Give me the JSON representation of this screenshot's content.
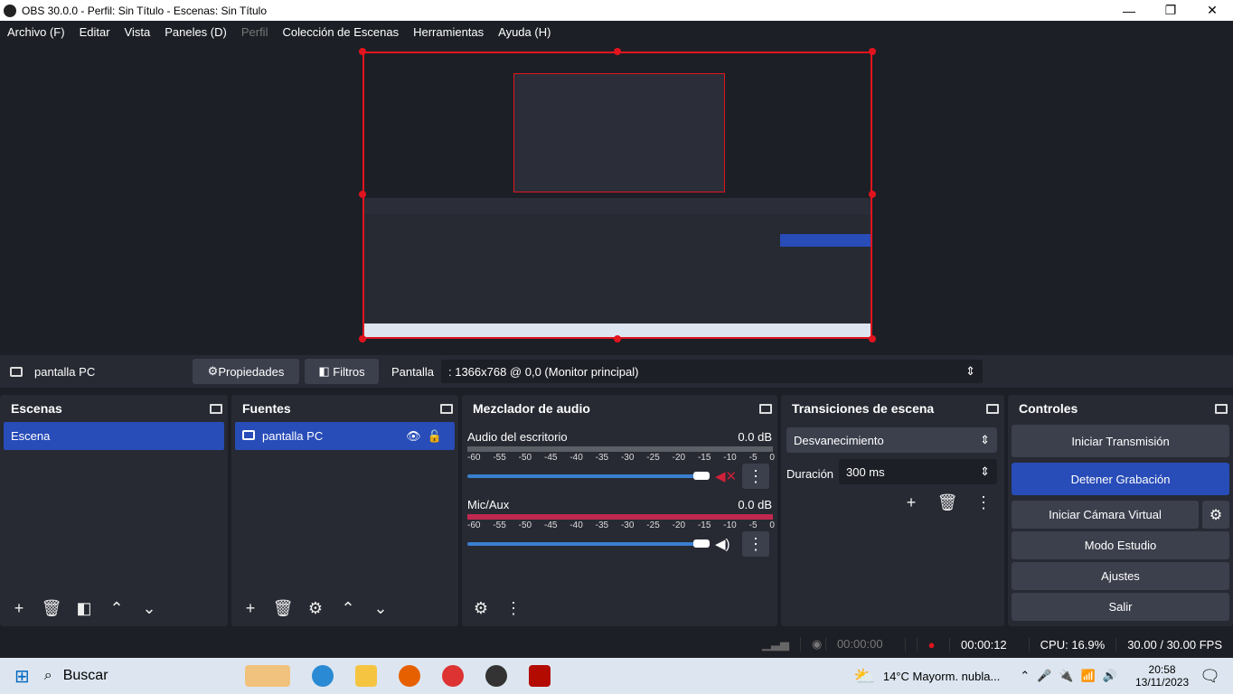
{
  "window": {
    "title": "OBS 30.0.0 - Perfil: Sin Título - Escenas: Sin Título",
    "minimize": "—",
    "maximize": "❐",
    "close": "✕"
  },
  "menu": [
    "Archivo (F)",
    "Editar",
    "Vista",
    "Paneles (D)",
    "Perfil",
    "Colección de Escenas",
    "Herramientas",
    "Ayuda (H)"
  ],
  "source_toolbar": {
    "source_name": "pantalla PC",
    "properties": "Propiedades",
    "filters": "Filtros",
    "display_label": "Pantalla",
    "display_value": ": 1366x768 @ 0,0 (Monitor principal)"
  },
  "scenes": {
    "title": "Escenas",
    "items": [
      "Escena"
    ]
  },
  "sources": {
    "title": "Fuentes",
    "items": [
      "pantalla PC"
    ]
  },
  "mixer": {
    "title": "Mezclador de audio",
    "ticks": [
      "-60",
      "-55",
      "-50",
      "-45",
      "-40",
      "-35",
      "-30",
      "-25",
      "-20",
      "-15",
      "-10",
      "-5",
      "0"
    ],
    "channels": [
      {
        "name": "Audio del escritorio",
        "db": "0.0 dB",
        "muted": true,
        "volume": 1.0
      },
      {
        "name": "Mic/Aux",
        "db": "0.0 dB",
        "muted": false,
        "volume": 1.0
      }
    ]
  },
  "transitions": {
    "title": "Transiciones de escena",
    "selected": "Desvanecimiento",
    "duration_label": "Duración",
    "duration_value": "300 ms"
  },
  "controls": {
    "title": "Controles",
    "buttons": [
      "Iniciar Transmisión",
      "Detener Grabación",
      "Iniciar Cámara Virtual",
      "Modo Estudio",
      "Ajustes",
      "Salir"
    ]
  },
  "status": {
    "stream_time": "00:00:00",
    "rec_time": "00:00:12",
    "cpu": "CPU: 16.9%",
    "fps": "30.00 / 30.00 FPS"
  },
  "taskbar": {
    "search": "Buscar",
    "weather": "14°C  Mayorm. nubla...",
    "time": "20:58",
    "date": "13/11/2023"
  },
  "colors": {
    "accent": "#284cb8",
    "record": "#e0141e",
    "selection": "#e0141e"
  }
}
